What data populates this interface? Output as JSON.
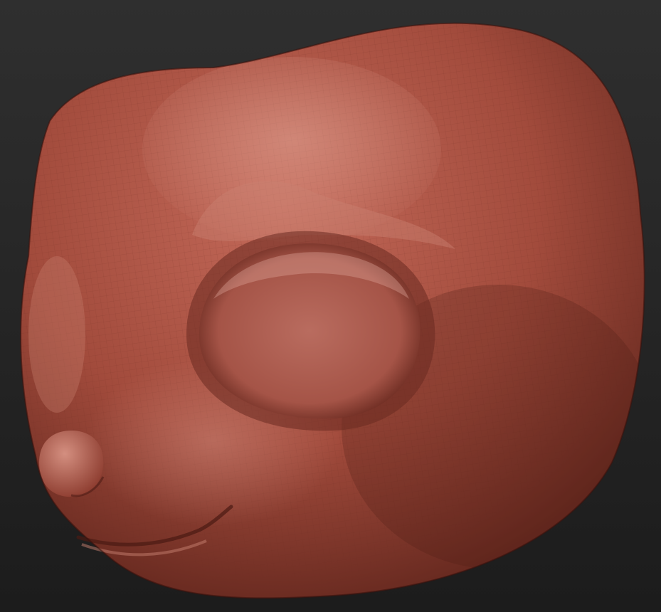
{
  "scene": {
    "subject": "sculpted-head-model",
    "colors": {
      "background_top": "#2f2f2f",
      "background_bottom": "#1c1c1c",
      "clay_light": "#c46a5a",
      "clay_mid": "#a24b3c",
      "clay_dark": "#5e241b",
      "highlight": "#d89a8c",
      "wire": "#7a3428"
    }
  }
}
